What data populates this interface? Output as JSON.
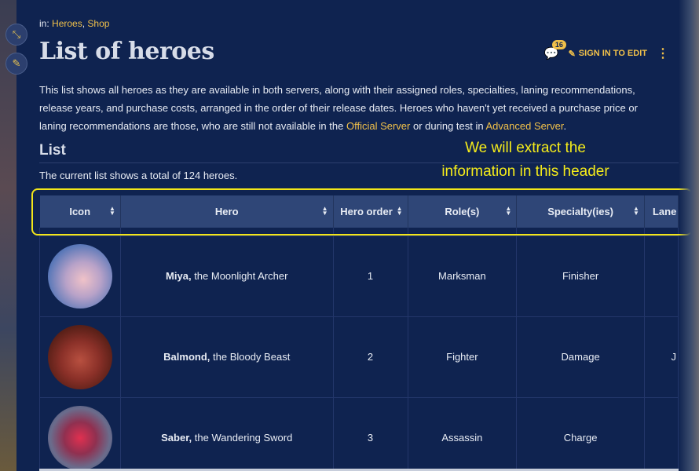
{
  "breadcrumb": {
    "prefix": "in:",
    "links": [
      "Heroes",
      "Shop"
    ]
  },
  "page_title": "List of heroes",
  "actions": {
    "comment_count": "16",
    "sign_in": "SIGN IN TO EDIT"
  },
  "intro": {
    "text1": "This list shows all heroes as they are available in both servers, along with their assigned roles, specialties, laning recommendations, release years, and purchase costs, arranged in the order of their release dates. Heroes who haven't yet received a purchase price or laning recommendations are those, who are still not available in the",
    "link1": "Official Server",
    "text2": "or during test in",
    "link2": "Advanced Server",
    "text3": "."
  },
  "section": {
    "title": "List",
    "count_text": "The current list shows a total of 124 heroes."
  },
  "annotation": {
    "line1": "We will extract the",
    "line2": "information in this header"
  },
  "table": {
    "headers": [
      "Icon",
      "Hero",
      "Hero order",
      "Role(s)",
      "Specialty(ies)",
      "Lane"
    ],
    "rows": [
      {
        "name": "Miya,",
        "title": "the Moonlight Archer",
        "order": "1",
        "role": "Marksman",
        "specialty": "Finisher",
        "lane": ""
      },
      {
        "name": "Balmond,",
        "title": "the Bloody Beast",
        "order": "2",
        "role": "Fighter",
        "specialty": "Damage",
        "lane": "J"
      },
      {
        "name": "Saber,",
        "title": "the Wandering Sword",
        "order": "3",
        "role": "Assassin",
        "specialty": "Charge",
        "lane": ""
      }
    ]
  },
  "colors": {
    "background": "#0f2350",
    "accent": "#f0c04a",
    "header_bg": "#2f4677",
    "annotation": "#f5ec1a"
  }
}
